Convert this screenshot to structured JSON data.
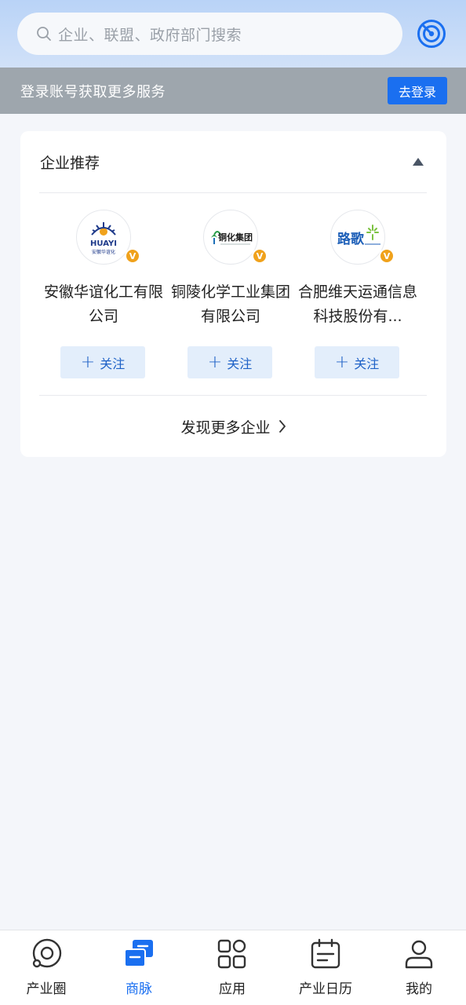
{
  "search": {
    "placeholder": "企业、联盟、政府部门搜索"
  },
  "login_bar": {
    "message": "登录账号获取更多服务",
    "button": "去登录"
  },
  "recommend": {
    "title": "企业推荐",
    "companies": [
      {
        "name": "安徽华谊化工有限公司",
        "logo_text": "HUAYI",
        "logo_subtext": "安徽华谊化",
        "verified_badge": "V",
        "follow_label": "关注"
      },
      {
        "name": "铜陵化学工业集团有限公司",
        "logo_text": "铜化集团",
        "verified_badge": "V",
        "follow_label": "关注"
      },
      {
        "name": "合肥维天运通信息科技股份有...",
        "logo_text": "路歌",
        "verified_badge": "V",
        "follow_label": "关注"
      }
    ],
    "more_link": "发现更多企业"
  },
  "tabbar": {
    "tabs": [
      {
        "label": "产业圈",
        "icon": "circle-icon"
      },
      {
        "label": "商脉",
        "icon": "network-icon"
      },
      {
        "label": "应用",
        "icon": "apps-grid-icon"
      },
      {
        "label": "产业日历",
        "icon": "calendar-icon"
      },
      {
        "label": "我的",
        "icon": "user-icon"
      }
    ],
    "active": "商脉"
  },
  "colors": {
    "accent": "#1a6ff0",
    "follow_bg": "#e3eefb",
    "badge": "#f0a21c",
    "login_bar_bg": "#9ea6ad"
  }
}
